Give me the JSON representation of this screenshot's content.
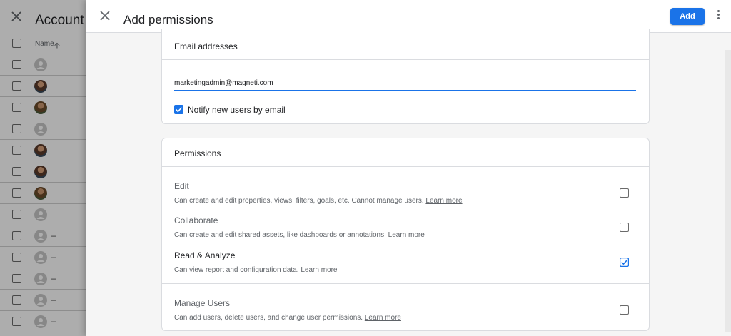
{
  "background": {
    "title": "Account p",
    "column_header": "Name",
    "rows": [
      {
        "avatar": "placeholder",
        "dash": ""
      },
      {
        "avatar": "photo",
        "dash": ""
      },
      {
        "avatar": "photo2",
        "dash": ""
      },
      {
        "avatar": "placeholder",
        "dash": ""
      },
      {
        "avatar": "photo",
        "dash": ""
      },
      {
        "avatar": "photo",
        "dash": ""
      },
      {
        "avatar": "photo2",
        "dash": ""
      },
      {
        "avatar": "placeholder",
        "dash": ""
      },
      {
        "avatar": "placeholder",
        "dash": "–"
      },
      {
        "avatar": "placeholder",
        "dash": "–"
      },
      {
        "avatar": "placeholder",
        "dash": "–"
      },
      {
        "avatar": "placeholder",
        "dash": "–"
      },
      {
        "avatar": "placeholder",
        "dash": "–"
      }
    ]
  },
  "drawer": {
    "title": "Add permissions",
    "add_label": "Add"
  },
  "email_card": {
    "header": "Email addresses",
    "email_value": "marketingadmin@magneti.com",
    "notify_label": "Notify new users by email",
    "notify_checked": true
  },
  "permissions_card": {
    "header": "Permissions",
    "items": [
      {
        "name": "Edit",
        "desc": "Can create and edit properties, views, filters, goals, etc. Cannot manage users.",
        "link": "Learn more",
        "checked": false,
        "muted": true
      },
      {
        "name": "Collaborate",
        "desc": "Can create and edit shared assets, like dashboards or annotations.",
        "link": "Learn more",
        "checked": false,
        "muted": true
      },
      {
        "name": "Read & Analyze",
        "desc": "Can view report and configuration data.",
        "link": "Learn more",
        "checked": true,
        "muted": false
      },
      {
        "name": "Manage Users",
        "desc": "Can add users, delete users, and change user permissions.",
        "link": "Learn more",
        "checked": false,
        "muted": true
      }
    ]
  },
  "colors": {
    "accent": "#1a73e8",
    "scrim": "rgba(0,0,0,0.32)"
  }
}
